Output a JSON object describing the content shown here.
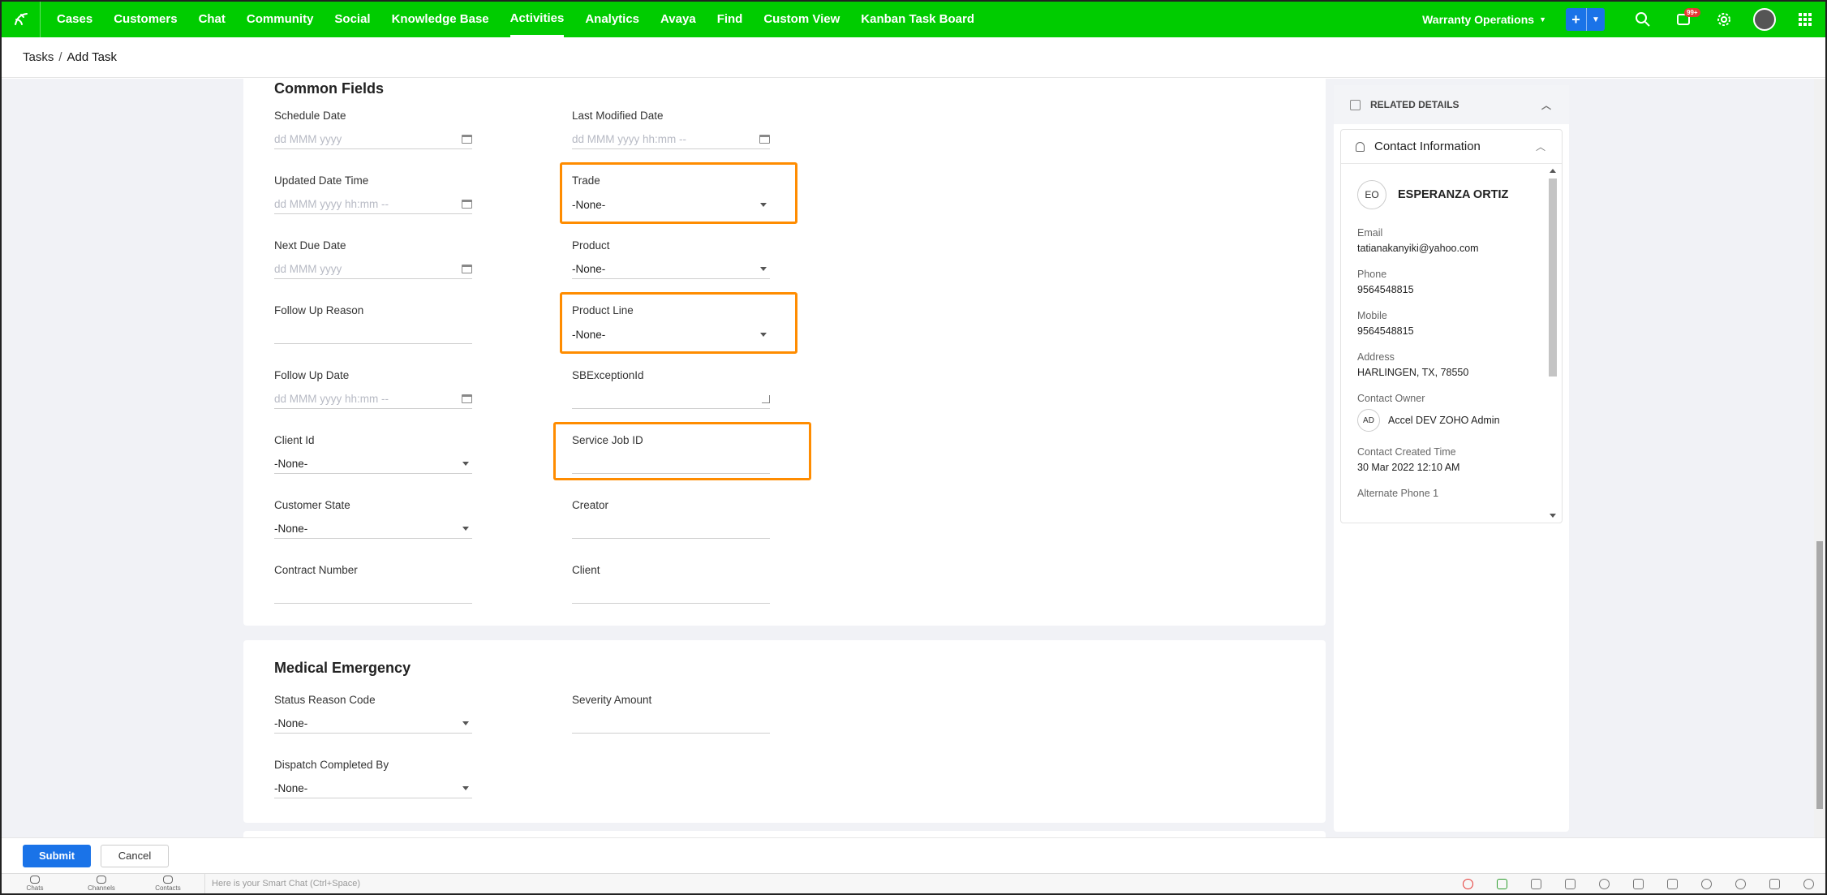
{
  "nav": {
    "items": [
      "Cases",
      "Customers",
      "Chat",
      "Community",
      "Social",
      "Knowledge Base",
      "Activities",
      "Analytics",
      "Avaya",
      "Find",
      "Custom View",
      "Kanban Task Board"
    ],
    "active": "Activities",
    "workspace": "Warranty Operations",
    "notification_badge": "99+",
    "colors": {
      "bar": "#00cc00",
      "accent": "#1a73e8",
      "highlight": "#ff8c00"
    }
  },
  "breadcrumb": {
    "parent": "Tasks",
    "separator": "/",
    "current": "Add Task"
  },
  "common_fields": {
    "title": "Common Fields",
    "schedule_date": {
      "label": "Schedule Date",
      "placeholder": "dd MMM yyyy"
    },
    "last_modified_date": {
      "label": "Last Modified Date",
      "placeholder": "dd MMM yyyy hh:mm --"
    },
    "updated_date_time": {
      "label": "Updated Date Time",
      "placeholder": "dd MMM yyyy hh:mm --"
    },
    "trade": {
      "label": "Trade",
      "value": "-None-"
    },
    "next_due_date": {
      "label": "Next Due Date",
      "placeholder": "dd MMM yyyy"
    },
    "product": {
      "label": "Product",
      "value": "-None-"
    },
    "follow_up_reason": {
      "label": "Follow Up Reason",
      "value": ""
    },
    "product_line": {
      "label": "Product Line",
      "value": "-None-"
    },
    "follow_up_date": {
      "label": "Follow Up Date",
      "placeholder": "dd MMM yyyy hh:mm --"
    },
    "sb_exception_id": {
      "label": "SBExceptionId",
      "value": ""
    },
    "client_id": {
      "label": "Client Id",
      "value": "-None-"
    },
    "service_job_id": {
      "label": "Service Job ID",
      "value": ""
    },
    "customer_state": {
      "label": "Customer State",
      "value": "-None-"
    },
    "creator": {
      "label": "Creator",
      "value": ""
    },
    "contract_number": {
      "label": "Contract Number",
      "value": ""
    },
    "client": {
      "label": "Client",
      "value": ""
    }
  },
  "medical_emergency": {
    "title": "Medical Emergency",
    "status_reason_code": {
      "label": "Status Reason Code",
      "value": "-None-"
    },
    "severity_amount": {
      "label": "Severity Amount",
      "value": ""
    },
    "dispatch_completed_by": {
      "label": "Dispatch Completed By",
      "value": "-None-"
    }
  },
  "related": {
    "header": "RELATED DETAILS",
    "contact_info_title": "Contact Information",
    "initials": "EO",
    "name": "ESPERANZA ORTIZ",
    "email_label": "Email",
    "email": "tatianakanyiki@yahoo.com",
    "phone_label": "Phone",
    "phone": "9564548815",
    "mobile_label": "Mobile",
    "mobile": "9564548815",
    "address_label": "Address",
    "address": "HARLINGEN, TX, 78550",
    "owner_label": "Contact Owner",
    "owner_initials": "AD",
    "owner": "Accel DEV ZOHO Admin",
    "created_label": "Contact Created Time",
    "created": "30 Mar 2022 12:10 AM",
    "alt_phone_label": "Alternate Phone 1"
  },
  "actions": {
    "submit": "Submit",
    "cancel": "Cancel"
  },
  "footer": {
    "items": [
      "Chats",
      "Channels",
      "Contacts"
    ],
    "smart_chat_placeholder": "Here is your Smart Chat (Ctrl+Space)"
  }
}
